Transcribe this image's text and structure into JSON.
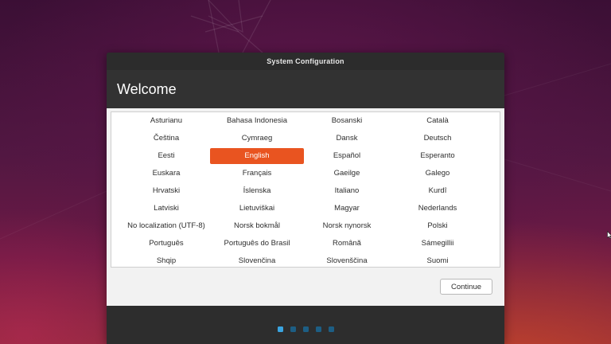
{
  "window": {
    "title": "System Configuration"
  },
  "header": {
    "title": "Welcome"
  },
  "languages": {
    "columns": [
      [
        "Asturianu",
        "Čeština",
        "Eesti",
        "Euskara",
        "Hrvatski",
        "Latviski",
        "No localization (UTF-8)",
        "Português",
        "Shqip"
      ],
      [
        "Bahasa Indonesia",
        "Cymraeg",
        "English",
        "Français",
        "Íslenska",
        "Lietuviškai",
        "Norsk bokmål",
        "Português do Brasil",
        "Slovenčina"
      ],
      [
        "Bosanski",
        "Dansk",
        "Español",
        "Gaeilge",
        "Italiano",
        "Magyar",
        "Norsk nynorsk",
        "Română",
        "Slovenščina"
      ],
      [
        "Català",
        "Deutsch",
        "Esperanto",
        "Galego",
        "Kurdî",
        "Nederlands",
        "Polski",
        "Sámegillii",
        "Suomi"
      ]
    ],
    "selected": "English"
  },
  "actions": {
    "continue_label": "Continue"
  },
  "progress": {
    "total_steps": 5,
    "current_step": 1
  },
  "colors": {
    "accent": "#e95420",
    "dot_active": "#3aa4e0",
    "dot_inactive": "#1d5e84"
  }
}
